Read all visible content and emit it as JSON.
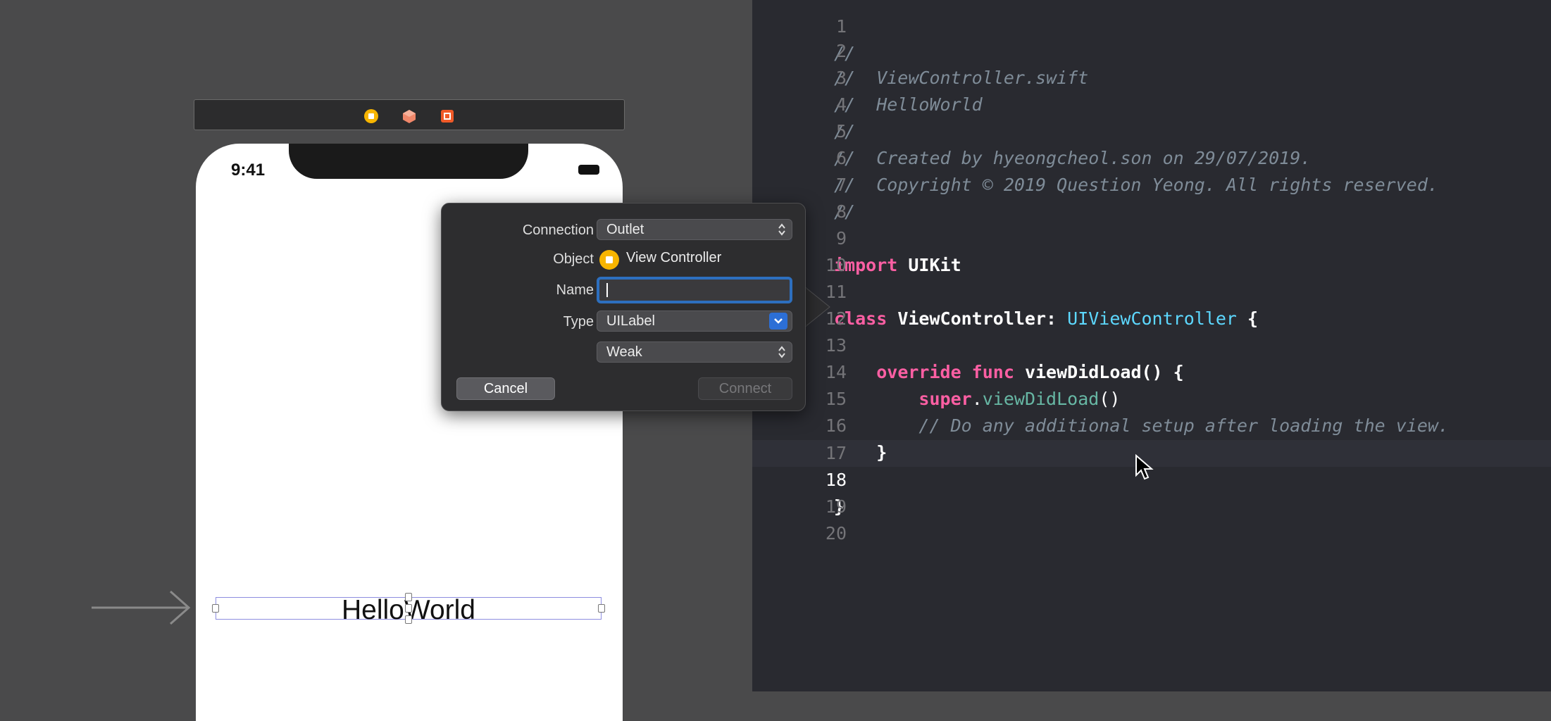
{
  "canvas": {
    "status_time": "9:41",
    "label_text": "HelloWorld"
  },
  "popover": {
    "connection_label": "Connection",
    "connection_value": "Outlet",
    "object_label": "Object",
    "object_value": "View Controller",
    "name_label": "Name",
    "name_value": "",
    "type_label": "Type",
    "type_value": "UILabel",
    "storage_value": "Weak",
    "cancel_label": "Cancel",
    "connect_label": "Connect"
  },
  "editor": {
    "current_line": 18,
    "lines": [
      {
        "n": "1",
        "text": "//"
      },
      {
        "n": "2",
        "text": "//  ViewController.swift"
      },
      {
        "n": "3",
        "text": "//  HelloWorld"
      },
      {
        "n": "4",
        "text": "//"
      },
      {
        "n": "5",
        "text": "//  Created by hyeongcheol.son on 29/07/2019."
      },
      {
        "n": "6",
        "text": "//  Copyright © 2019 Question Yeong. All rights reserved."
      },
      {
        "n": "7",
        "text": "//"
      },
      {
        "n": "8",
        "text": ""
      },
      {
        "n": "9",
        "text": "import UIKit"
      },
      {
        "n": "10",
        "text": ""
      },
      {
        "n": "11",
        "text": "class ViewController: UIViewController {"
      },
      {
        "n": "12",
        "text": ""
      },
      {
        "n": "13",
        "text": "    override func viewDidLoad() {"
      },
      {
        "n": "14",
        "text": "        super.viewDidLoad()"
      },
      {
        "n": "15",
        "text": "        // Do any additional setup after loading the view."
      },
      {
        "n": "16",
        "text": "    }"
      },
      {
        "n": "17",
        "text": ""
      },
      {
        "n": "18",
        "text": "}"
      },
      {
        "n": "19",
        "text": ""
      },
      {
        "n": "20",
        "text": ""
      }
    ]
  },
  "colors": {
    "keyword": "#fc5fa3",
    "type": "#5dd8ff",
    "function": "#67b7a4",
    "comment": "#7f8c98",
    "accent": "#2c6fd6"
  }
}
